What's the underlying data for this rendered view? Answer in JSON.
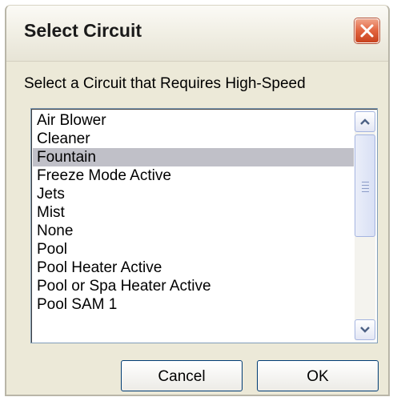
{
  "dialog": {
    "title": "Select Circuit",
    "prompt": "Select a Circuit that Requires High-Speed"
  },
  "list": {
    "items": [
      "Air Blower",
      "Cleaner",
      "Fountain",
      "Freeze Mode Active",
      "Jets",
      "Mist",
      "None",
      "Pool",
      "Pool Heater Active",
      "Pool or Spa Heater Active",
      "Pool SAM 1"
    ],
    "selected_item": "Fountain"
  },
  "buttons": {
    "cancel_label": "Cancel",
    "ok_label": "OK"
  },
  "icons": {
    "close": "close-icon",
    "scroll_up": "chevron-up-icon",
    "scroll_down": "chevron-down-icon"
  },
  "colors": {
    "dialog_bg": "#ece9d8",
    "close_button": "#e2643f",
    "selection_bg": "#c0c0c8",
    "button_border": "#003c74"
  }
}
